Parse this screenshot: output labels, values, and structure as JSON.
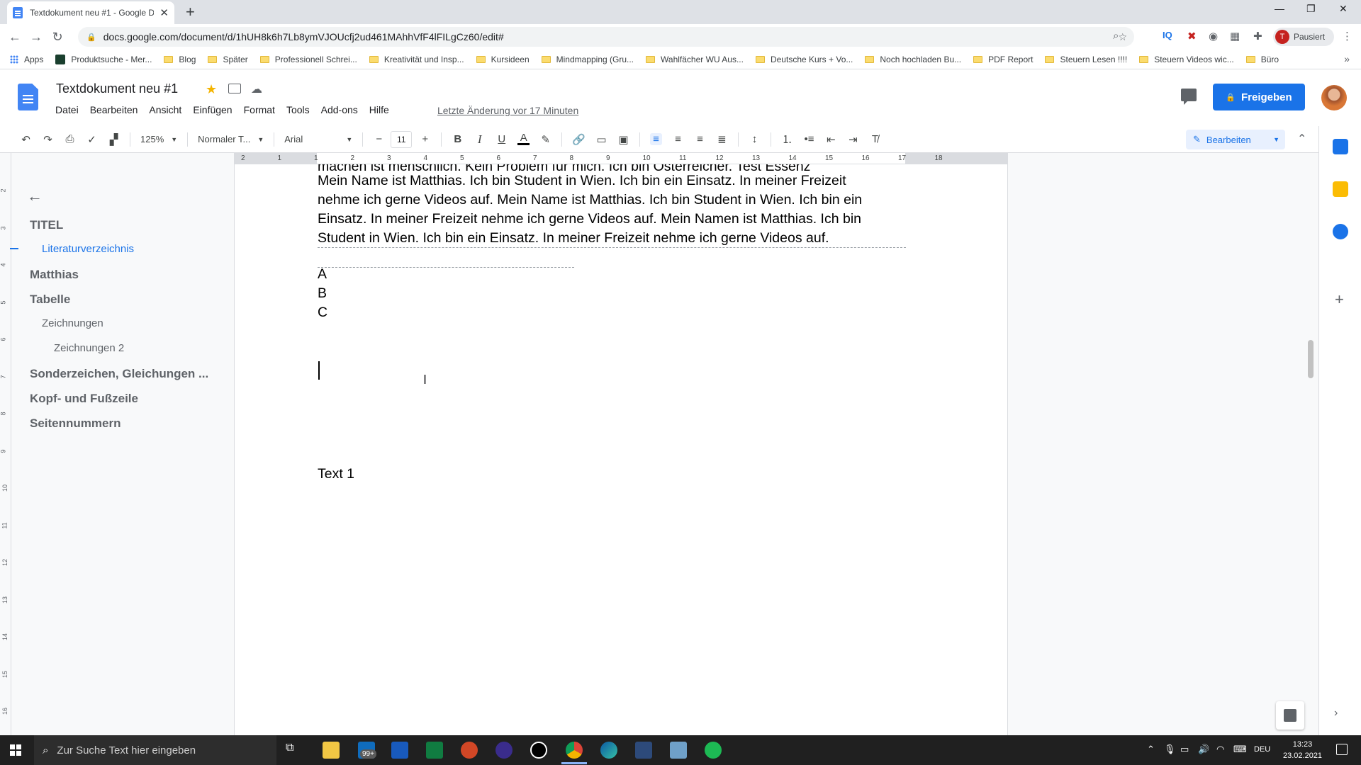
{
  "browser": {
    "tab_title": "Textdokument neu #1 - Google D",
    "url": "docs.google.com/document/d/1hUH8k6h7Lb8ymVJOUcfj2ud461MAhhVfF4lFILgCz60/edit#",
    "profile_label": "Pausiert",
    "profile_initial": "T",
    "bookmarks": [
      "Apps",
      "Produktsuche - Mer...",
      "Blog",
      "Später",
      "Professionell Schrei...",
      "Kreativität und Insp...",
      "Kursideen",
      "Mindmapping (Gru...",
      "Wahlfächer WU Aus...",
      "Deutsche Kurs + Vo...",
      "Noch hochladen Bu...",
      "PDF Report",
      "Steuern Lesen !!!!",
      "Steuern Videos wic...",
      "Büro"
    ]
  },
  "docs": {
    "title": "Textdokument neu #1",
    "menu": [
      "Datei",
      "Bearbeiten",
      "Ansicht",
      "Einfügen",
      "Format",
      "Tools",
      "Add-ons",
      "Hilfe"
    ],
    "last_edit": "Letzte Änderung vor 17 Minuten",
    "share_label": "Freigeben",
    "toolbar": {
      "zoom": "125%",
      "style": "Normaler T...",
      "font": "Arial",
      "font_size": "11",
      "mode": "Bearbeiten"
    }
  },
  "ruler": {
    "h_labels": [
      "2",
      "1",
      "1",
      "2",
      "3",
      "4",
      "5",
      "6",
      "7",
      "8",
      "9",
      "10",
      "11",
      "12",
      "13",
      "14",
      "15",
      "16",
      "17",
      "18"
    ],
    "v_labels": [
      "2",
      "3",
      "4",
      "5",
      "6",
      "7",
      "8",
      "9",
      "10",
      "11",
      "12",
      "13",
      "14",
      "15",
      "16"
    ]
  },
  "outline": {
    "items": [
      {
        "label": "TITEL",
        "level": 1
      },
      {
        "label": "Literaturverzeichnis",
        "level": 2,
        "active": true
      },
      {
        "label": "Matthias",
        "level": 1
      },
      {
        "label": "Tabelle",
        "level": 1
      },
      {
        "label": "Zeichnungen",
        "level": 2
      },
      {
        "label": "Zeichnungen 2",
        "level": 3
      },
      {
        "label": "Sonderzeichen, Gleichungen ...",
        "level": 1
      },
      {
        "label": "Kopf- und Fußzeile",
        "level": 1
      },
      {
        "label": "Seitennummern",
        "level": 1
      }
    ]
  },
  "document": {
    "cut_line": "machen ist menschlich. Kein Problem für mich. Ich bin Österreicher. Test Essenz",
    "paragraph_lines": [
      "Mein Name ist Matthias. Ich bin Student in Wien. Ich bin ein Einsatz. In meiner Freizeit",
      "nehme ich gerne Videos auf. Mein Name ist Matthias. Ich bin Student in Wien. Ich bin ein",
      "Einsatz. In meiner Freizeit nehme ich gerne Videos auf. Mein Namen ist Matthias. Ich bin",
      "Student in Wien. Ich bin ein Einsatz. In meiner Freizeit nehme ich gerne Videos auf."
    ],
    "list": [
      "A",
      "B",
      "C"
    ],
    "text1": "Text 1"
  },
  "taskbar": {
    "search_placeholder": "Zur Suche Text hier eingeben",
    "mail_badge": "99+",
    "language": "DEU",
    "time": "13:23",
    "date": "23.02.2021"
  }
}
